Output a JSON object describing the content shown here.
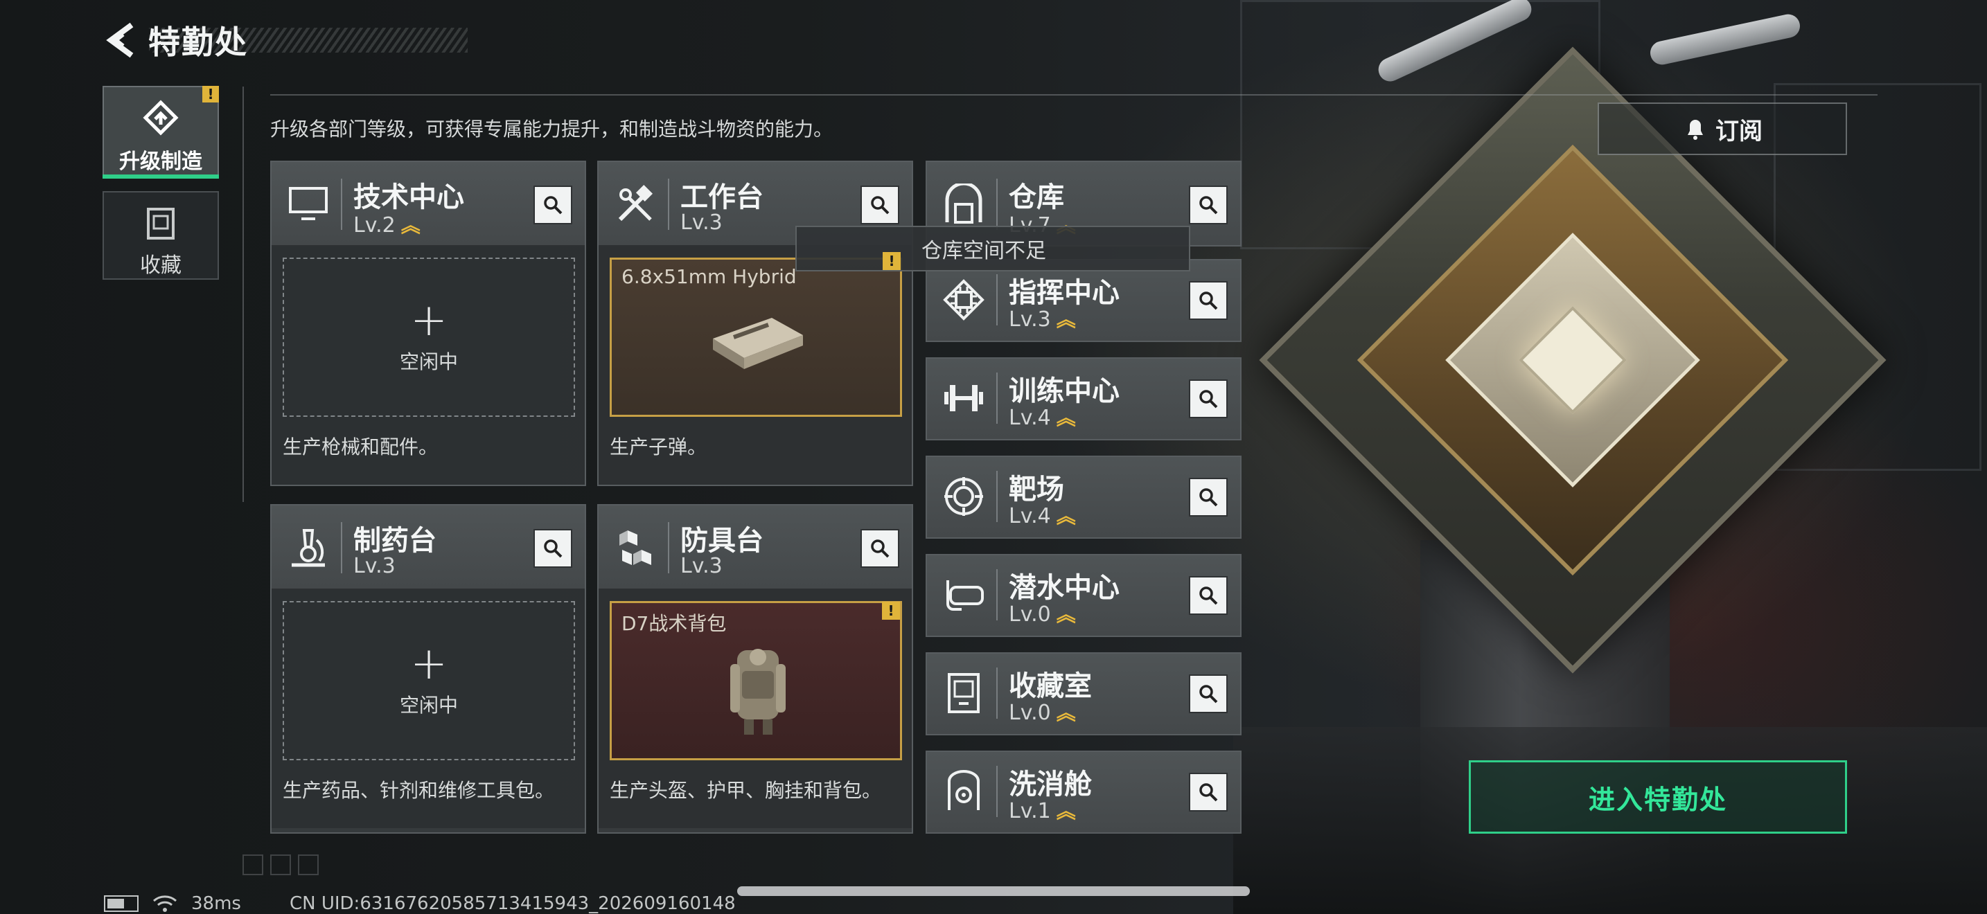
{
  "header": {
    "title": "特勤处"
  },
  "tabs": [
    {
      "label": "升级制造",
      "badge": "!"
    },
    {
      "label": "收藏"
    }
  ],
  "description": "升级各部门等级，可获得专属能力提升，和制造战斗物资的能力。",
  "subscribe": {
    "label": "订阅"
  },
  "enter_button": {
    "label": "进入特勤处"
  },
  "tooltip": {
    "text": "仓库空间不足"
  },
  "facilities_large": [
    {
      "name": "技术中心",
      "level": "Lv.2",
      "upgradable": true,
      "slot_state": "空闲中",
      "slot_item": "",
      "description": "生产枪械和配件。"
    },
    {
      "name": "工作台",
      "level": "Lv.3",
      "upgradable": false,
      "slot_state": "",
      "slot_item": "6.8x51mm Hybrid",
      "description": "生产子弹。"
    },
    {
      "name": "制药台",
      "level": "Lv.3",
      "upgradable": false,
      "slot_state": "空闲中",
      "slot_item": "",
      "description": "生产药品、针剂和维修工具包。"
    },
    {
      "name": "防具台",
      "level": "Lv.3",
      "upgradable": false,
      "slot_state": "",
      "slot_item": "D7战术背包",
      "slot_badge": "!",
      "description": "生产头盔、护甲、胸挂和背包。"
    }
  ],
  "facilities_small": [
    {
      "name": "仓库",
      "level": "Lv.7",
      "upgradable": true
    },
    {
      "name": "指挥中心",
      "level": "Lv.3",
      "upgradable": true
    },
    {
      "name": "训练中心",
      "level": "Lv.4",
      "upgradable": true
    },
    {
      "name": "靶场",
      "level": "Lv.4",
      "upgradable": true
    },
    {
      "name": "潜水中心",
      "level": "Lv.0",
      "upgradable": true
    },
    {
      "name": "收藏室",
      "level": "Lv.0",
      "upgradable": true
    },
    {
      "name": "洗消舱",
      "level": "Lv.1",
      "upgradable": true
    }
  ],
  "status_bar": {
    "ping": "38ms",
    "uid": "CN UID:63167620585713415943_202609160148",
    "battery_level": 0.6
  },
  "icons": {
    "back": "back-arrow-icon",
    "search": "magnifier-icon",
    "upgrade": "double-chevron-up-icon"
  },
  "colors": {
    "accent": "#2fcf89",
    "upgrade": "#e9b93b",
    "warning": "#e0b43a"
  }
}
